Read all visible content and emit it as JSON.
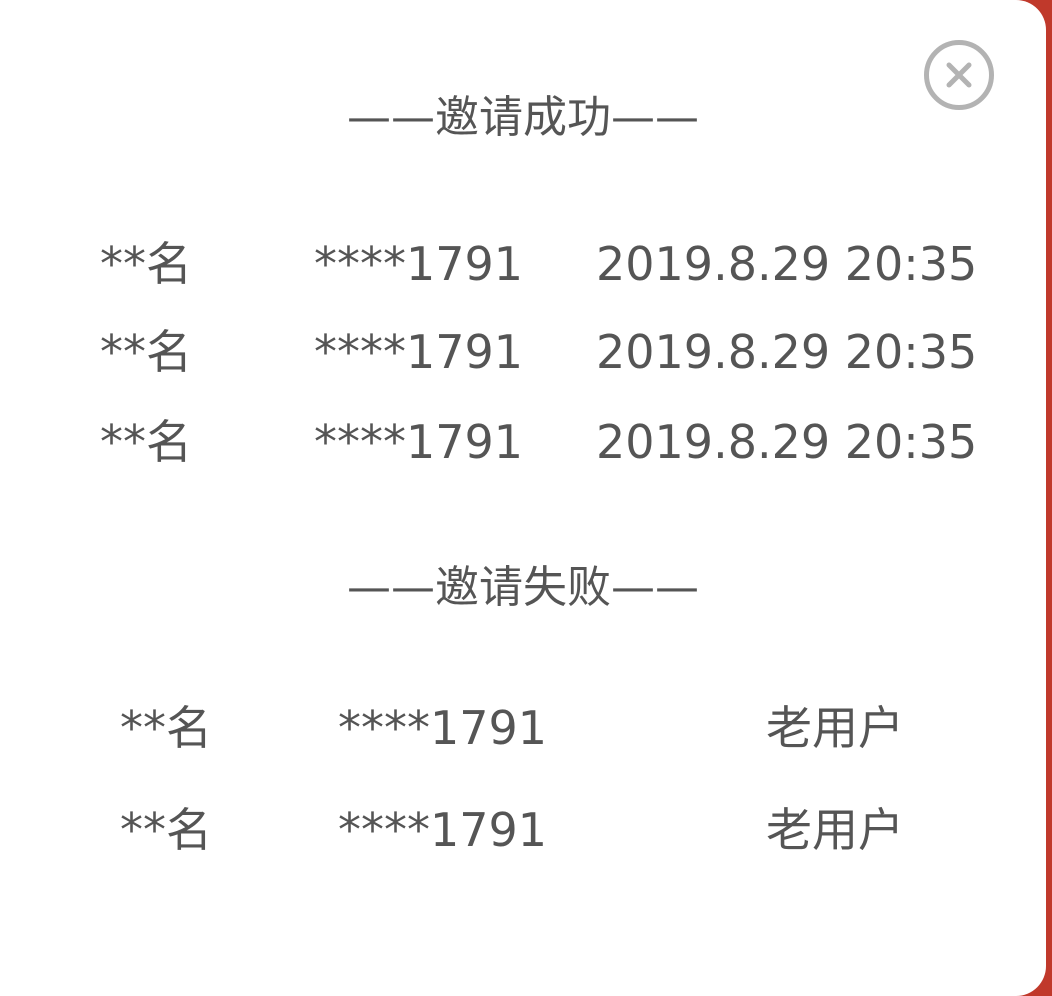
{
  "dialog": {
    "close_icon": "close-icon"
  },
  "success": {
    "title": "——邀请成功——",
    "rows": [
      {
        "name": "**名",
        "phone": "****1791",
        "time": "2019.8.29 20:35"
      },
      {
        "name": "**名",
        "phone": "****1791",
        "time": "2019.8.29 20:35"
      },
      {
        "name": "**名",
        "phone": "****1791",
        "time": "2019.8.29 20:35"
      }
    ]
  },
  "failure": {
    "title": "——邀请失败——",
    "rows": [
      {
        "name": "**名",
        "phone": "****1791",
        "status": "老用户"
      },
      {
        "name": "**名",
        "phone": "****1791",
        "status": "老用户"
      }
    ]
  },
  "colors": {
    "text": "#555555",
    "close_icon": "#b3b3b3",
    "background": "#ffffff",
    "backdrop_edge": "#c0392b"
  }
}
